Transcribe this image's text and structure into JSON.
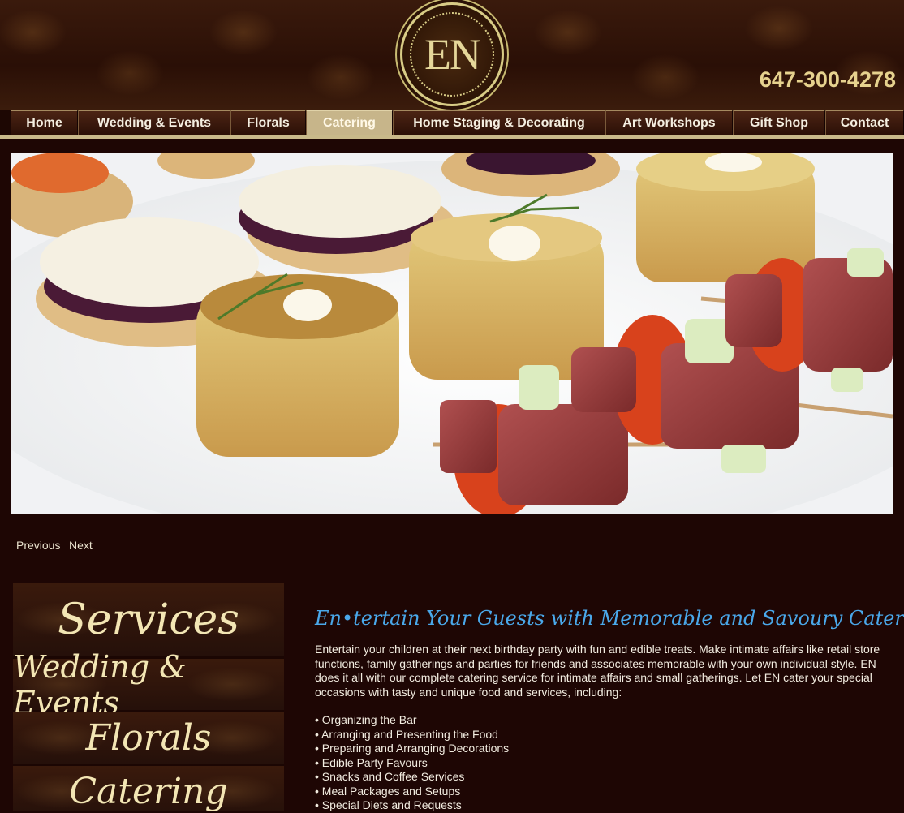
{
  "header": {
    "logo_text": "EN",
    "phone": "647-300-4278"
  },
  "nav": {
    "items": [
      {
        "label": "Home"
      },
      {
        "label": "Wedding & Events"
      },
      {
        "label": "Florals"
      },
      {
        "label": "Catering",
        "active": true
      },
      {
        "label": "Home Staging & Decorating"
      },
      {
        "label": "Art Workshops"
      },
      {
        "label": "Gift Shop"
      },
      {
        "label": "Contact"
      }
    ]
  },
  "slideshow": {
    "previous_label": "Previous",
    "next_label": "Next"
  },
  "services": {
    "title": "Services",
    "items": [
      "Wedding & Events",
      "Florals",
      "Catering"
    ]
  },
  "content": {
    "headline": "En•tertain Your Guests with Memorable and Savoury Catering",
    "intro": "Entertain your children at their next birthday party with fun and edible treats. Make intimate affairs like retail store functions, family gatherings and parties for friends and associates memorable with your own individual style. EN does it all with our complete catering service for intimate affairs and small gatherings. Let EN cater your special occasions with tasty and unique food and services, including:",
    "bullets": [
      "• Organizing the Bar",
      "• Arranging and Presenting the Food",
      "• Preparing and Arranging Decorations",
      "• Edible Party Favours",
      "• Snacks and Coffee Services",
      "• Meal Packages and Setups",
      "• Special Diets and Requests"
    ]
  },
  "colors": {
    "background": "#1e0604",
    "accent_gold": "#e6d28e",
    "headline_blue": "#4aa8ea",
    "nav_active": "#c7b58a"
  }
}
